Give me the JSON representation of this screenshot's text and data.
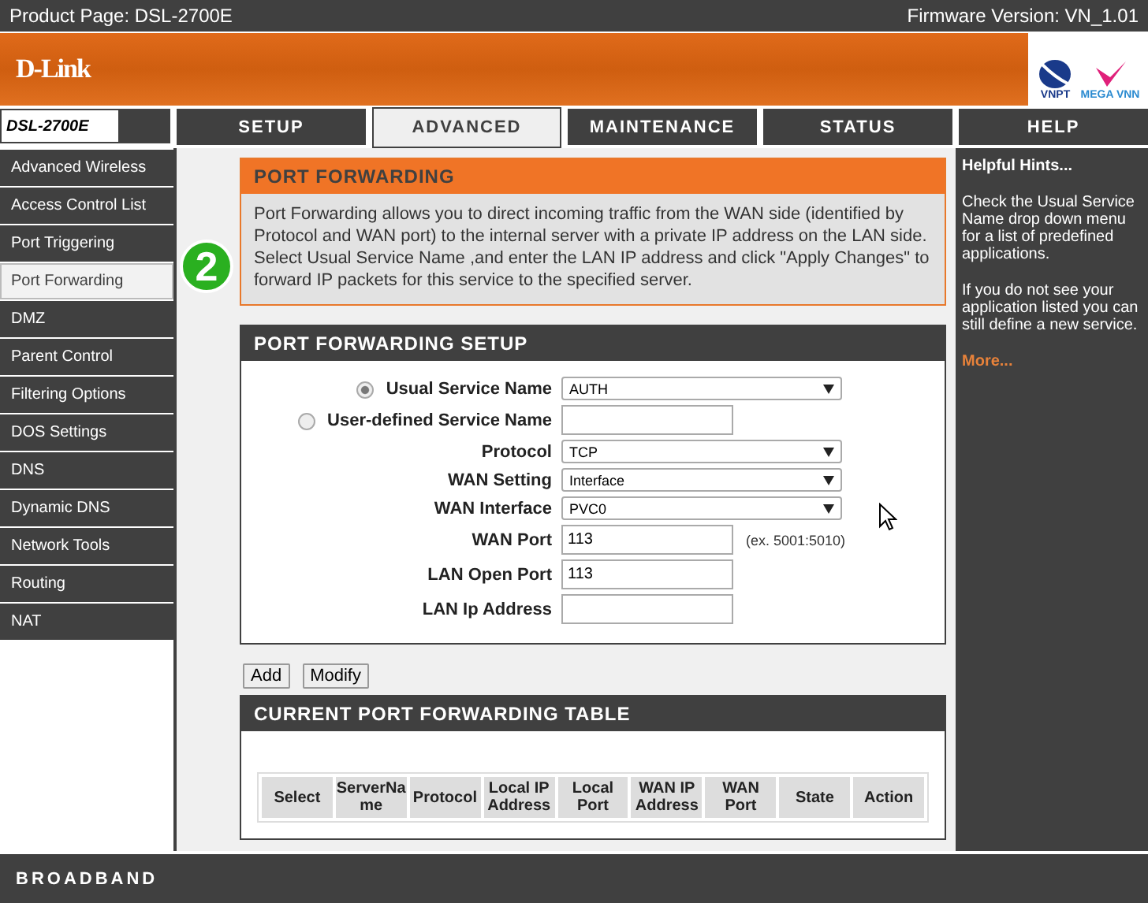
{
  "top_bar": {
    "product": "Product Page: DSL-2700E",
    "firmware": "Firmware Version: VN_1.01"
  },
  "banner": {
    "logo": "D-Link",
    "partners": [
      "VNPT",
      "MEGA VNN"
    ]
  },
  "model": "DSL-2700E",
  "tabs": [
    {
      "label": "SETUP",
      "selected": false
    },
    {
      "label": "ADVANCED",
      "selected": true
    },
    {
      "label": "MAINTENANCE",
      "selected": false
    },
    {
      "label": "STATUS",
      "selected": false
    },
    {
      "label": "HELP",
      "selected": false
    }
  ],
  "sidebar": {
    "items": [
      {
        "label": "Advanced Wireless",
        "selected": false
      },
      {
        "label": "Access Control List",
        "selected": false
      },
      {
        "label": "Port Triggering",
        "selected": false
      },
      {
        "label": "Port Forwarding",
        "selected": true
      },
      {
        "label": "DMZ",
        "selected": false
      },
      {
        "label": "Parent Control",
        "selected": false
      },
      {
        "label": "Filtering Options",
        "selected": false
      },
      {
        "label": "DOS Settings",
        "selected": false
      },
      {
        "label": "DNS",
        "selected": false
      },
      {
        "label": "Dynamic DNS",
        "selected": false
      },
      {
        "label": "Network Tools",
        "selected": false
      },
      {
        "label": "Routing",
        "selected": false
      },
      {
        "label": "NAT",
        "selected": false
      }
    ]
  },
  "step_badge": "2",
  "port_forwarding": {
    "title": "PORT FORWARDING",
    "description": "Port Forwarding allows you to direct incoming traffic from the WAN side (identified by Protocol and WAN port) to the internal server with a private IP address on the LAN side. Select Usual Service Name ,and enter the LAN IP address and click \"Apply Changes\" to forward IP packets for this service to the specified server."
  },
  "setup": {
    "title": "PORT FORWARDING SETUP",
    "fields": [
      {
        "kind": "select",
        "label": "Usual Service Name",
        "selected": true,
        "value": "AUTH"
      },
      {
        "kind": "text",
        "label": "User-defined Service Name",
        "selected": false
      },
      {
        "kind": "select",
        "label": "Protocol",
        "value": "TCP"
      },
      {
        "kind": "select",
        "label": "WAN Setting",
        "value": "Interface"
      },
      {
        "kind": "select",
        "label": "WAN Interface",
        "value": "PVC0"
      },
      {
        "kind": "text",
        "label": "WAN Port",
        "value": "113",
        "hint": "(ex. 5001:5010)"
      },
      {
        "kind": "text",
        "label": "LAN Open Port",
        "value": "113"
      },
      {
        "kind": "text",
        "label": "LAN Ip Address"
      }
    ]
  },
  "buttons": [
    "Add",
    "Modify"
  ],
  "table": {
    "title": "CURRENT PORT FORWARDING TABLE",
    "columns": [
      "Select",
      "ServerName",
      "Protocol",
      "Local IP Address",
      "Local Port",
      "WAN IP Address",
      "WAN Port",
      "State",
      "Action"
    ]
  },
  "hints": {
    "title": "Helpful Hints...",
    "paragraphs": [
      "Check the Usual Service Name drop down menu for a list of predefined applications.",
      "If you do not see your application listed you can still define a new service."
    ],
    "link": "More..."
  },
  "footer": "BROADBAND"
}
